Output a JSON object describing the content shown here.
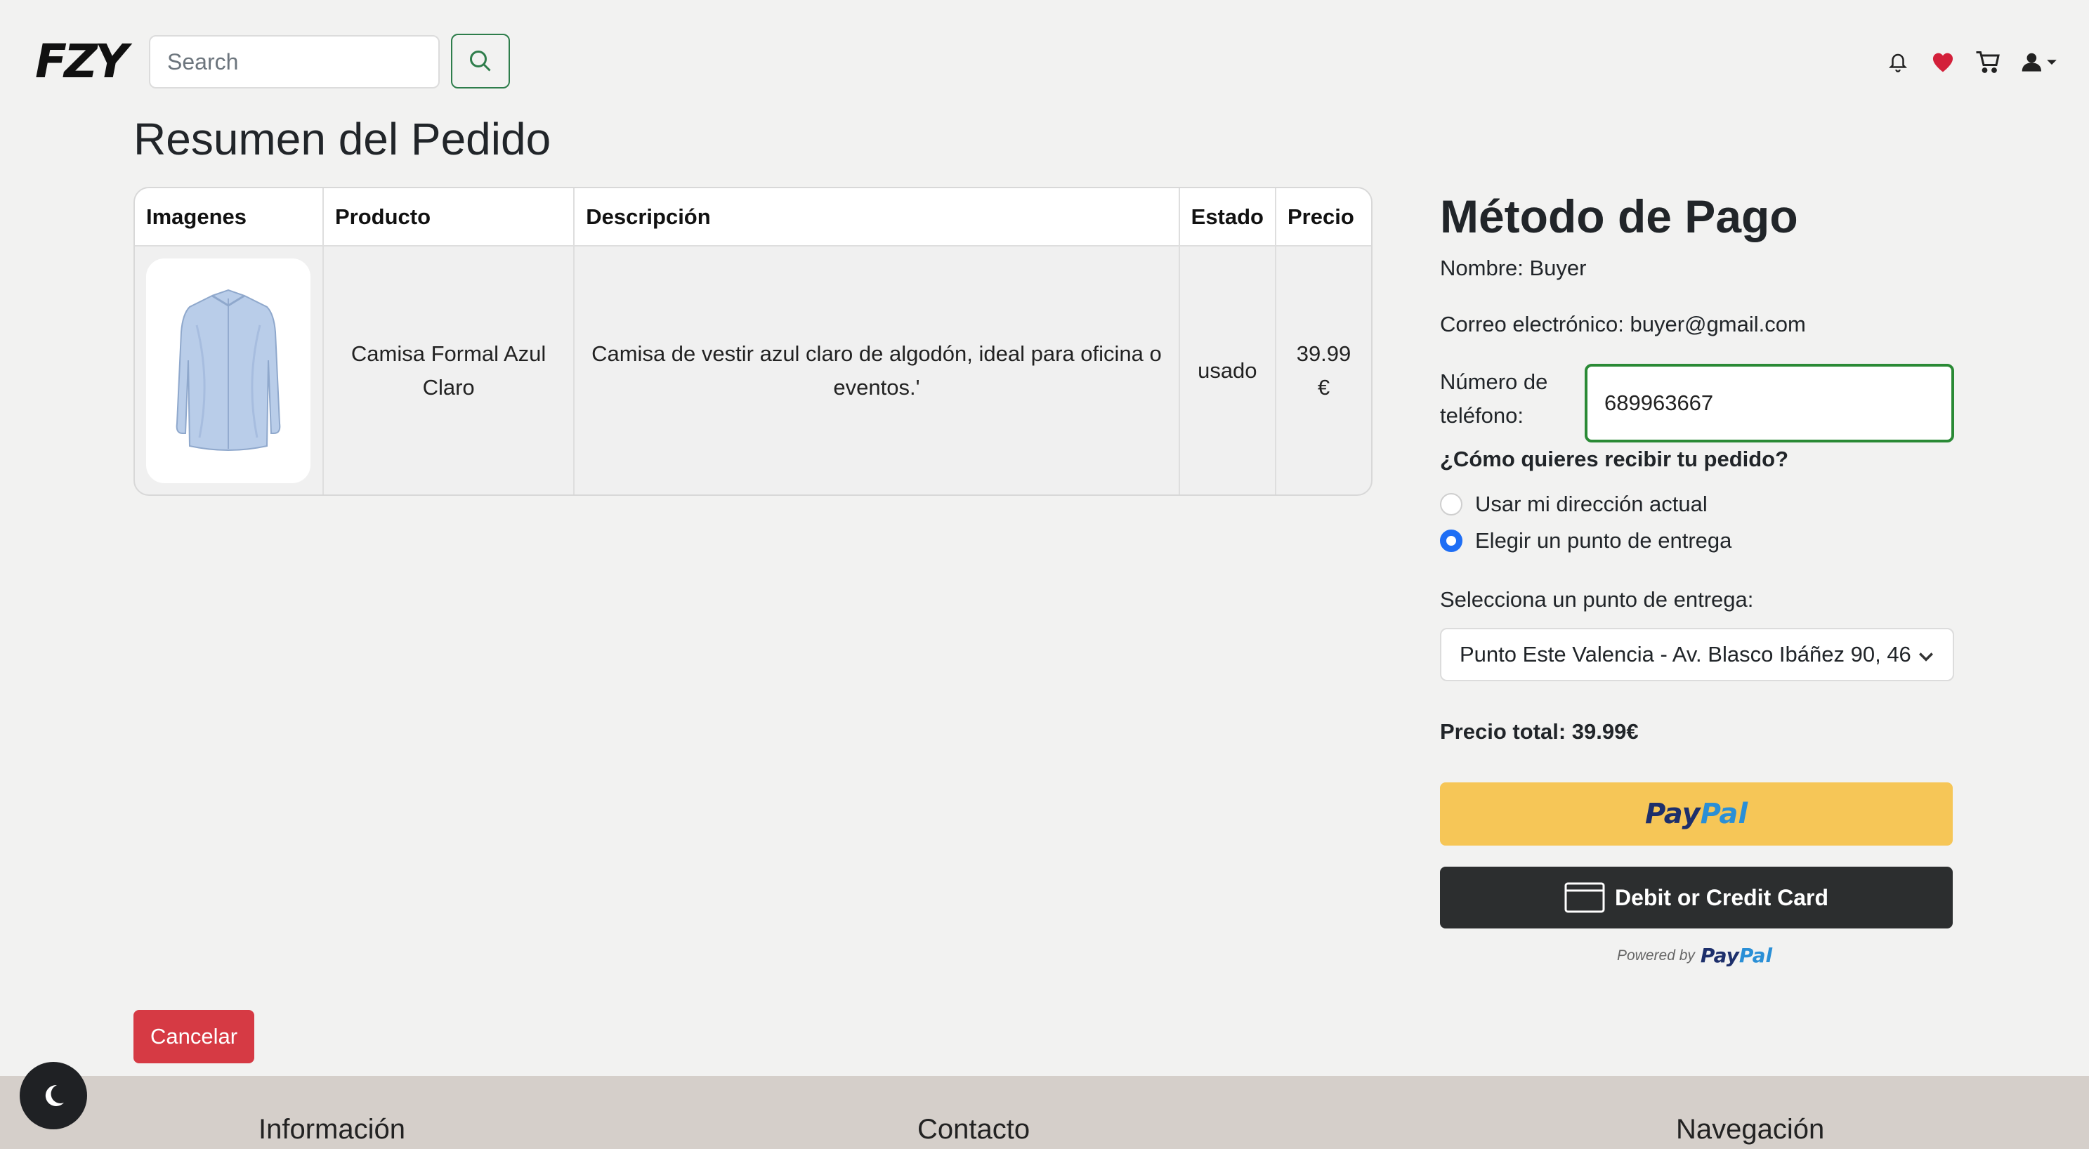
{
  "header": {
    "logo": "FZY",
    "search_placeholder": "Search"
  },
  "page_title": "Resumen del Pedido",
  "table": {
    "headers": [
      "Imagenes",
      "Producto",
      "Descripción",
      "Estado",
      "Precio"
    ],
    "rows": [
      {
        "product": "Camisa Formal Azul Claro",
        "description": "Camisa de vestir azul claro de algodón, ideal para oficina o eventos.'",
        "state": "usado",
        "price": "39.99 €"
      }
    ]
  },
  "payment": {
    "title": "Método de Pago",
    "name_line": "Nombre: Buyer",
    "email_line": "Correo electrónico: buyer@gmail.com",
    "phone_label": "Número de teléfono:",
    "phone_value": "689963667",
    "delivery_question": "¿Cómo quieres recibir tu pedido?",
    "option_current_address": "Usar mi dirección actual",
    "option_pickup_point": "Elegir un punto de entrega",
    "selected_option": "pickup",
    "select_label": "Selecciona un punto de entrega:",
    "select_value": "Punto Este Valencia - Av. Blasco Ibáñez 90, 46",
    "total": "Precio total: 39.99€",
    "paypal_dark": "Pay",
    "paypal_light": "Pal",
    "card_button": "Debit or Credit Card",
    "powered_by": "Powered by"
  },
  "cancel_button": "Cancelar",
  "footer": {
    "col1": "Información",
    "col2": "Contacto",
    "col3": "Navegación"
  },
  "colors": {
    "accent_green": "#2e7d4b",
    "radio_blue": "#1e6ef5",
    "paypal_yellow": "#f6c657",
    "cancel_red": "#d63a44",
    "footer_bg": "#d5cfca"
  }
}
